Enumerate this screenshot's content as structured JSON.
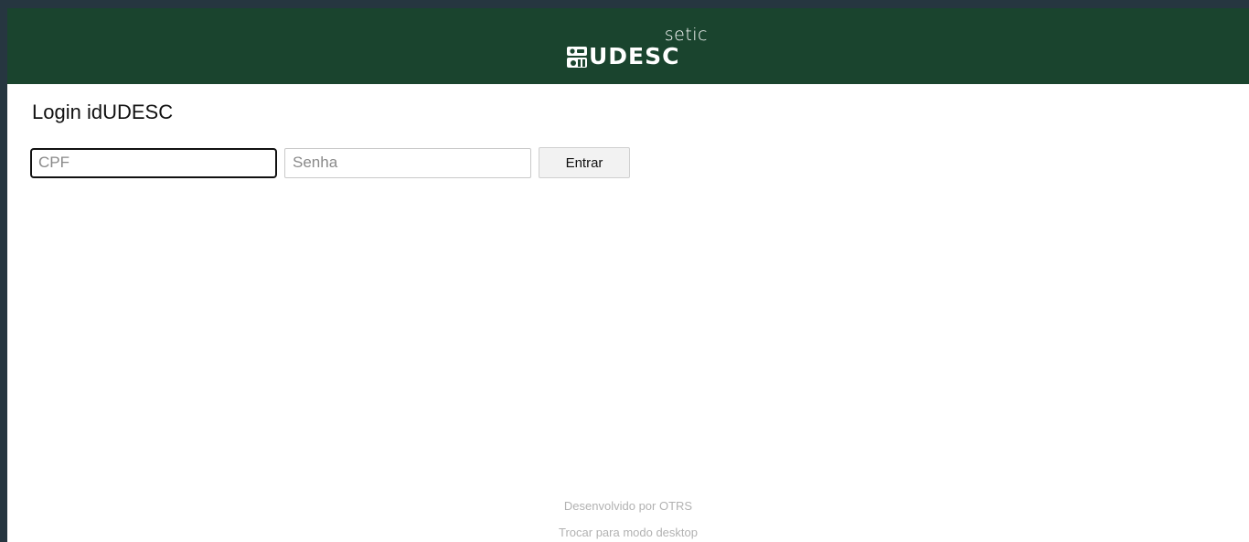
{
  "header": {
    "brand_sub": "setic",
    "brand_name": "UDESC",
    "logo_icon": "udesc-logo-icon",
    "background": "#1a442e"
  },
  "login": {
    "title": "Login idUDESC",
    "cpf": {
      "placeholder": "CPF",
      "value": ""
    },
    "password": {
      "placeholder": "Senha",
      "value": ""
    },
    "submit_label": "Entrar"
  },
  "footer": {
    "powered_by": "Desenvolvido por OTRS",
    "desktop_link": "Trocar para modo desktop"
  }
}
